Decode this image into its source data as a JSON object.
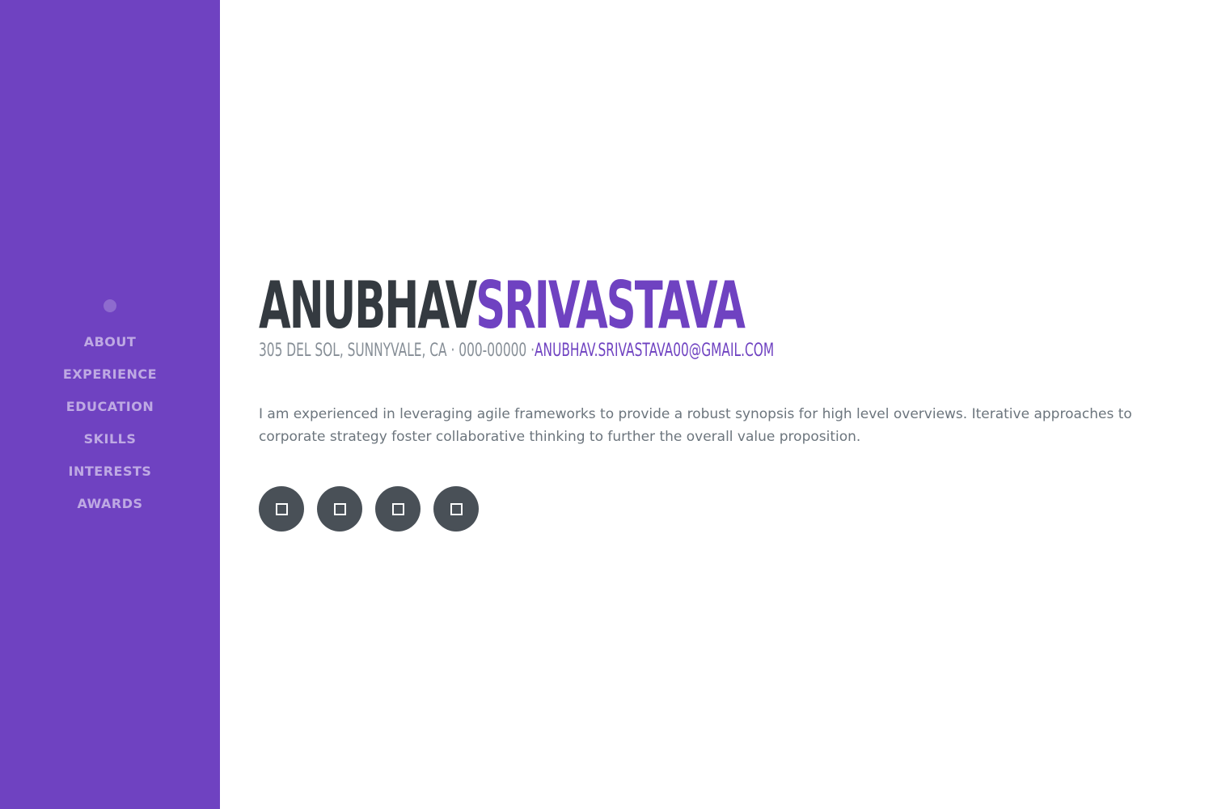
{
  "sidebar": {
    "items": [
      {
        "label": "ABOUT"
      },
      {
        "label": "EXPERIENCE"
      },
      {
        "label": "EDUCATION"
      },
      {
        "label": "SKILLS"
      },
      {
        "label": "INTERESTS"
      },
      {
        "label": "AWARDS"
      }
    ]
  },
  "about": {
    "first_name": "ANUBHAV",
    "last_name": "SRIVASTAVA",
    "address": "305 DEL SOL, SUNNYVALE, CA · 000-00000 ·",
    "email": "ANUBHAV.SRIVASTAVA00@GMAIL.COM",
    "bio": "I am experienced in leveraging agile frameworks to provide a robust synopsis for high level overviews. Iterative approaches to corporate strategy foster collaborative thinking to further the overall value proposition."
  },
  "social": {
    "icons": [
      "social-icon-1",
      "social-icon-2",
      "social-icon-3",
      "social-icon-4"
    ]
  },
  "colors": {
    "primary": "#6f42c1",
    "dark": "#343a40",
    "muted": "#868e96",
    "social_bg": "#495057"
  }
}
